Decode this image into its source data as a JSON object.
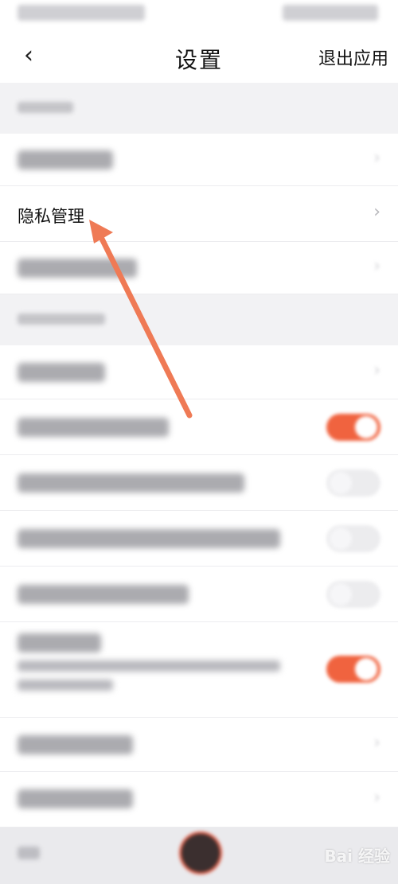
{
  "nav": {
    "back_glyph": "‹",
    "title": "设置",
    "exit_label": "退出应用"
  },
  "rows": {
    "privacy": {
      "label": "隐私管理",
      "chevron": "›"
    },
    "generic_chevron": "›"
  },
  "toggles": [
    {
      "name": "toggle-1",
      "on": true
    },
    {
      "name": "toggle-2",
      "on": false
    },
    {
      "name": "toggle-3",
      "on": false
    },
    {
      "name": "toggle-4",
      "on": false
    },
    {
      "name": "toggle-5",
      "on": true
    }
  ],
  "watermark": {
    "text": "Bai 经验"
  },
  "colors": {
    "accent": "#f0633f",
    "annotation_arrow": "#ef7a55",
    "background": "#f2f2f4",
    "row": "#ffffff"
  },
  "icons": {
    "back": "back-chevron-icon",
    "row_arrow": "chevron-right-icon"
  }
}
